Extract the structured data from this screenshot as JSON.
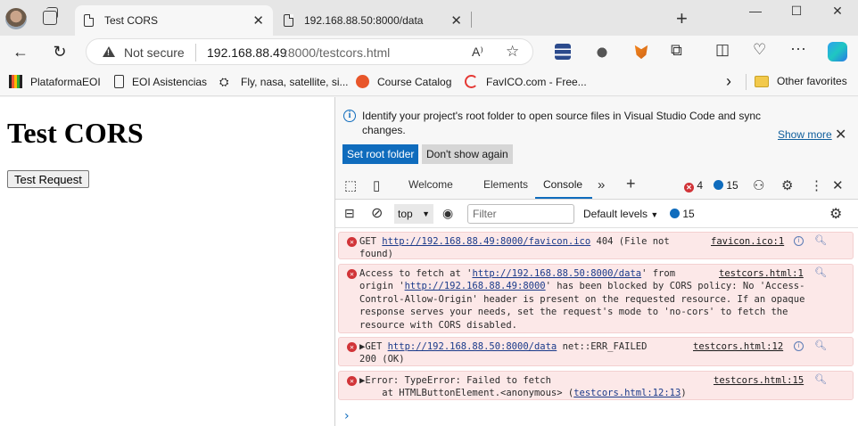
{
  "browser": {
    "tabs": [
      {
        "title": "Test CORS",
        "active": true
      },
      {
        "title": "192.168.88.50:8000/data",
        "active": false
      }
    ],
    "new_tab": "+",
    "window_controls": {
      "minimize": "—",
      "maximize": "☐",
      "close": "✕"
    }
  },
  "toolbar": {
    "security_label": "Not secure",
    "url_host": "192.168.88.49",
    "url_rest": ":8000/testcors.html",
    "read_aloud": "A⁾",
    "icons": [
      "back-icon",
      "refresh-icon",
      "read-aloud-icon",
      "favorite-star-icon",
      "extension-icon",
      "split-screen-icon",
      "health-icon",
      "more-icon",
      "copilot-icon"
    ]
  },
  "bookmarks": {
    "items": [
      {
        "label": "PlataformaEOI",
        "icon": "bar-chart-icon"
      },
      {
        "label": "EOI Asistencias",
        "icon": "document-icon"
      },
      {
        "label": "Fly, nasa, satellite, si...",
        "icon": "satellite-icon"
      },
      {
        "label": "Course Catalog",
        "icon": "course-icon"
      },
      {
        "label": "FavICO.com - Free...",
        "icon": "favico-icon"
      }
    ],
    "overflow": "›",
    "other_favorites": "Other favorites"
  },
  "page": {
    "heading": "Test CORS",
    "button_label": "Test Request"
  },
  "devtools": {
    "infobar": {
      "text": "Identify your project's root folder to open source files in Visual Studio Code and sync changes.",
      "show_more": "Show more",
      "set_root": "Set root folder",
      "dont_show": "Don't show again"
    },
    "tabs": [
      {
        "label": "Welcome"
      },
      {
        "label": "Elements"
      },
      {
        "label": "Console",
        "active": true
      }
    ],
    "error_count": "4",
    "message_count": "15",
    "console_toolbar": {
      "context": "top",
      "filter_placeholder": "Filter",
      "levels": "Default levels",
      "messages": "15"
    },
    "entries": [
      {
        "lines": [
          "GET ",
          "http://192.168.88.49:8000/favicon.ico",
          " 404 (File not",
          "found)"
        ],
        "source": "favicon.ico:1"
      },
      {
        "lines": [
          "Access to fetch at '",
          "http://192.168.88.50:8000/data",
          "' from",
          "origin '",
          "http://192.168.88.49:8000",
          "' has been blocked by CORS policy: No 'Access-",
          "Control-Allow-Origin' header is present on the requested resource. If an opaque",
          "response serves your needs, set the request's mode to 'no-cors' to fetch the",
          "resource with CORS disabled."
        ],
        "source": "testcors.html:1"
      },
      {
        "lines": [
          "▶GET ",
          "http://192.168.88.50:8000/data",
          " net::ERR_FAILED",
          "200 (OK)"
        ],
        "source": "testcors.html:12"
      },
      {
        "lines": [
          "▶Error: TypeError: Failed to fetch",
          "    at HTMLButtonElement.<anonymous> (",
          "testcors.html:12:13",
          ")"
        ],
        "source": "testcors.html:15"
      }
    ],
    "prompt": "›"
  },
  "colors": {
    "accent": "#0f6cbd",
    "error_bg": "#fce8e8",
    "error_icon": "#d13438"
  }
}
